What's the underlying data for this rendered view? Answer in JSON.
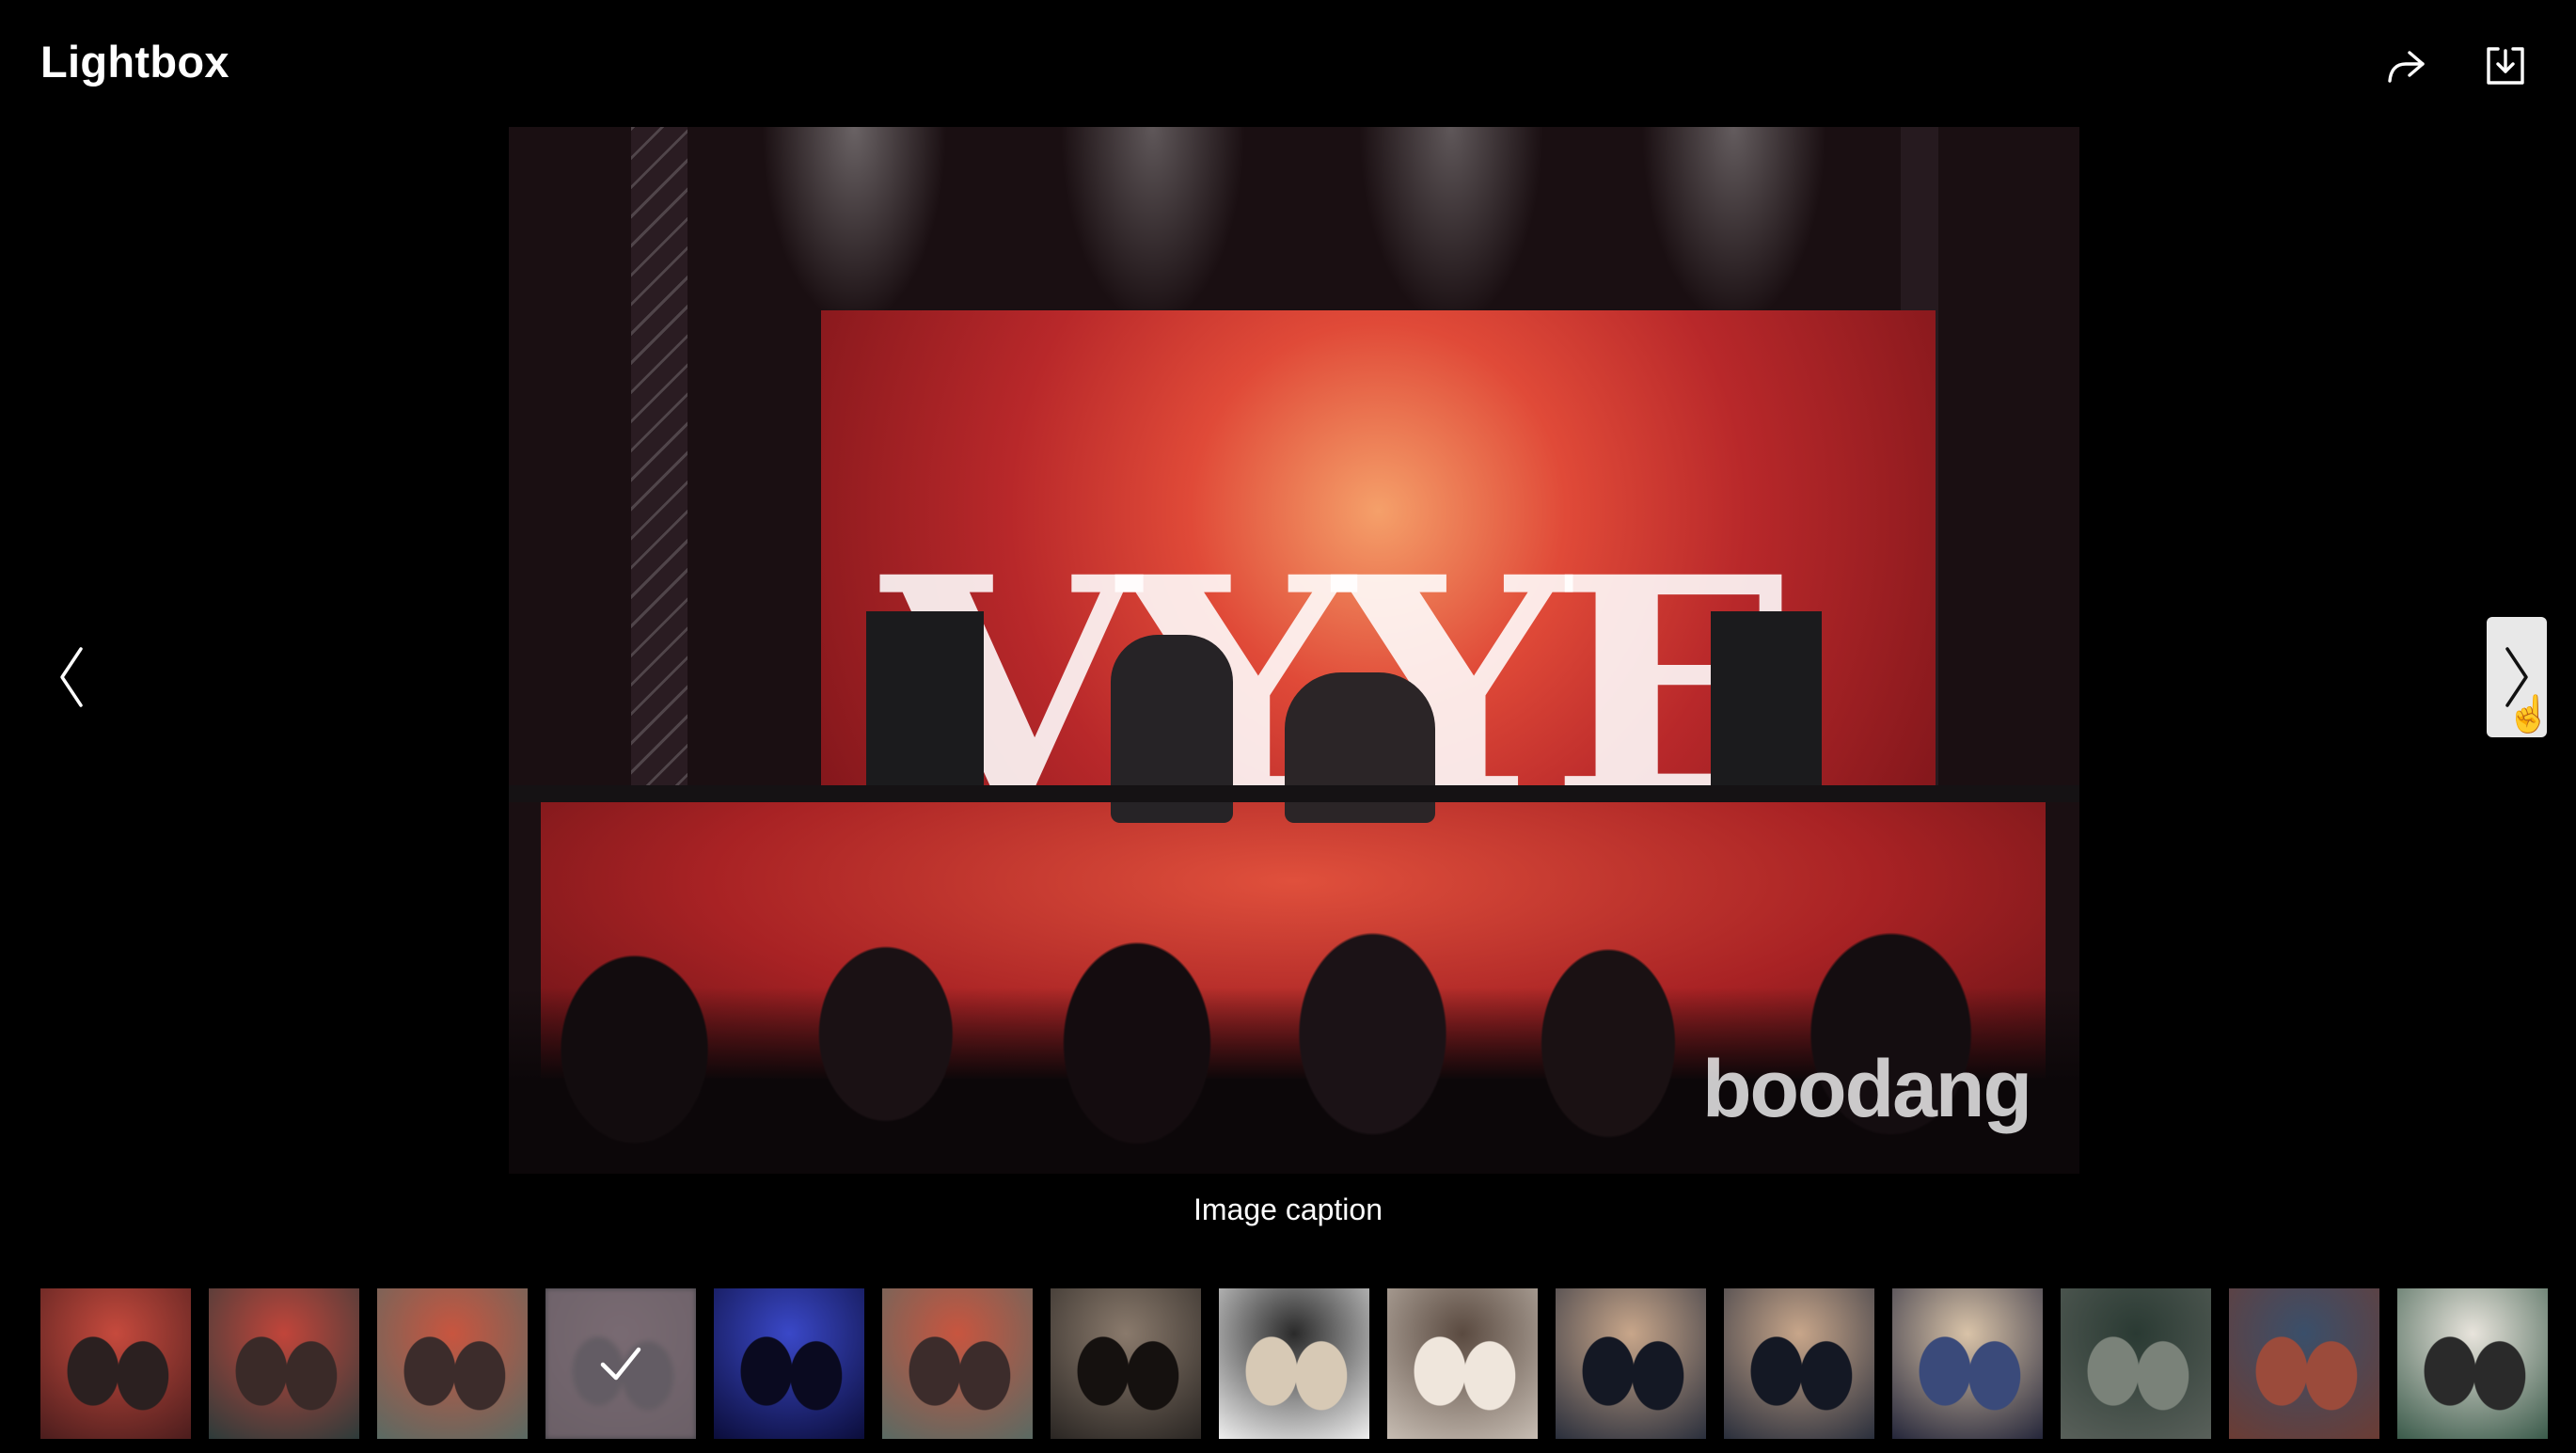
{
  "header": {
    "title": "Lightbox"
  },
  "toolbar": {
    "share_icon": "share-icon",
    "download_icon": "download-icon",
    "close_icon": "close-icon"
  },
  "main_image": {
    "caption": "Image caption",
    "watermark": "boodang",
    "screen_text": "VYYE"
  },
  "navigation": {
    "prev_icon": "chevron-left-icon",
    "next_icon": "chevron-right-icon"
  },
  "thumbnails": [
    {
      "selected": false,
      "palette": [
        "#4b1d1d",
        "#c64a3d",
        "#2b2020"
      ]
    },
    {
      "selected": false,
      "palette": [
        "#2d3b3a",
        "#c1453a",
        "#3a2a28"
      ]
    },
    {
      "selected": false,
      "palette": [
        "#5a6a63",
        "#c8553f",
        "#3c2c2b"
      ]
    },
    {
      "selected": true,
      "palette": [
        "#5b4248",
        "#7a5a60",
        "#4a3b40"
      ]
    },
    {
      "selected": false,
      "palette": [
        "#0b0d3a",
        "#3a48c8",
        "#0a0a20"
      ]
    },
    {
      "selected": false,
      "palette": [
        "#5a6a63",
        "#c8553f",
        "#3c2c2b"
      ]
    },
    {
      "selected": false,
      "palette": [
        "#2a2623",
        "#8a7a6c",
        "#15110f"
      ]
    },
    {
      "selected": false,
      "palette": [
        "#efefef",
        "#2a2a2a",
        "#d7c9b5"
      ]
    },
    {
      "selected": false,
      "palette": [
        "#c7bdb3",
        "#5a4a40",
        "#efe6dc"
      ]
    },
    {
      "selected": false,
      "palette": [
        "#2a2f3c",
        "#c8a68a",
        "#141824"
      ]
    },
    {
      "selected": false,
      "palette": [
        "#2a2f3c",
        "#c8a68a",
        "#141824"
      ]
    },
    {
      "selected": false,
      "palette": [
        "#24263a",
        "#d9c3a8",
        "#3a4a7a"
      ]
    },
    {
      "selected": false,
      "palette": [
        "#59605a",
        "#2a3a33",
        "#7a8279"
      ]
    },
    {
      "selected": false,
      "palette": [
        "#6b3c34",
        "#3a4f6a",
        "#9b4b3b"
      ]
    },
    {
      "selected": false,
      "palette": [
        "#3a5a4a",
        "#e8e4dc",
        "#2a2a2a"
      ]
    }
  ]
}
